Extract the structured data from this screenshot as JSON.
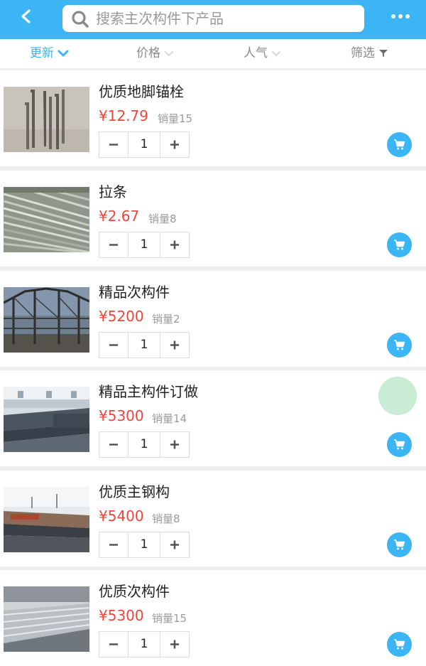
{
  "header": {
    "search_placeholder": "搜索主次构件下产品",
    "back_icon": "back-arrow-icon",
    "more_icon": "more-dots-icon",
    "color": "#3bb5f4"
  },
  "sort_bar": {
    "update": "更新",
    "price": "价格",
    "popularity": "人气",
    "filter": "筛选"
  },
  "products": [
    {
      "name": "优质地脚锚栓",
      "price": "¥12.79",
      "sales": "销量15",
      "qty": "1"
    },
    {
      "name": "拉条",
      "price": "¥2.67",
      "sales": "销量8",
      "qty": "1"
    },
    {
      "name": "精品次构件",
      "price": "¥5200",
      "sales": "销量2",
      "qty": "1"
    },
    {
      "name": "精品主构件订做",
      "price": "¥5300",
      "sales": "销量14",
      "qty": "1"
    },
    {
      "name": "优质主钢构",
      "price": "¥5400",
      "sales": "销量8",
      "qty": "1"
    },
    {
      "name": "优质次构件",
      "price": "¥5300",
      "sales": "销量15",
      "qty": "1"
    }
  ],
  "colors": {
    "accent": "#3bb5f4",
    "price": "#f0453b"
  }
}
